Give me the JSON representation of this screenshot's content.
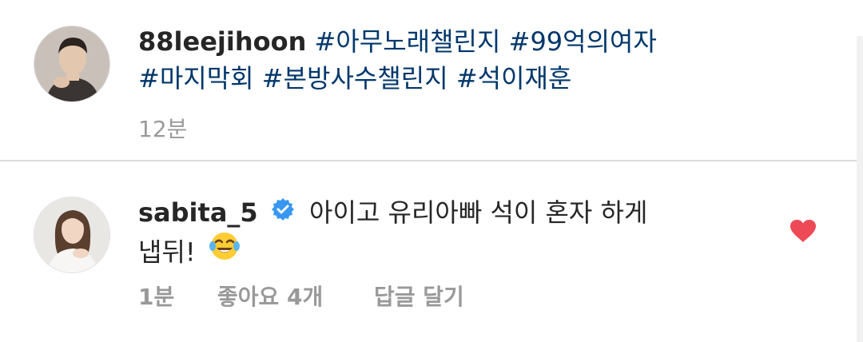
{
  "post": {
    "username": "88leejihoon",
    "hashtags_line1": [
      "#아무노래챌린지",
      "#99억의여자"
    ],
    "hashtags_line2": [
      "#마지막회",
      "#본방사수챌린지",
      "#석이재훈"
    ],
    "time": "12분"
  },
  "comment": {
    "username": "sabita_5",
    "text_line1": "아이고 유리아빠 석이 혼자 하게",
    "text_line2": "냅뒤!",
    "emoji": "tears-of-joy-emoji",
    "time": "1분",
    "likes": "좋아요 4개",
    "reply": "답글 달기",
    "liked": true
  },
  "colors": {
    "hashtag": "#00376b",
    "heart": "#ed4956",
    "meta": "#999999",
    "verified": "#3897f0"
  }
}
